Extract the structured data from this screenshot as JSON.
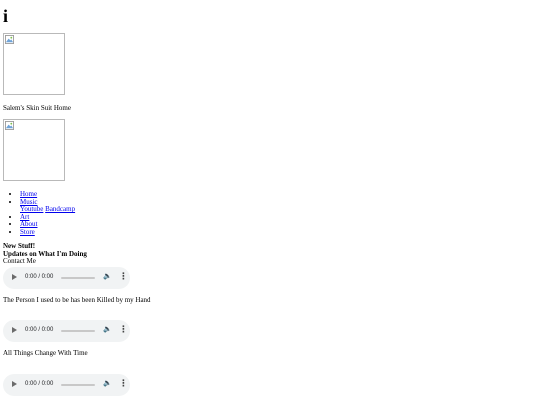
{
  "page": {
    "heading": "i",
    "caption": "Salem's Skin Suit Home"
  },
  "nav": {
    "items": [
      {
        "label": "Home"
      },
      {
        "label": "Music"
      },
      {
        "label": "Art"
      },
      {
        "label": "About"
      },
      {
        "label": "Store"
      }
    ],
    "music_sub": [
      {
        "label": "Youtube"
      },
      {
        "label": "Bandcamp"
      }
    ]
  },
  "sections": {
    "new_stuff": "New Stuff!",
    "updates": "Updates on What I'm Doing",
    "contact": "Contact Me"
  },
  "tracks": [
    {
      "title": "The Person I used to be has been Killed by my Hand"
    },
    {
      "title": "All Things Change With Time"
    }
  ],
  "audio": {
    "time_display": "0:00 / 0:00"
  }
}
